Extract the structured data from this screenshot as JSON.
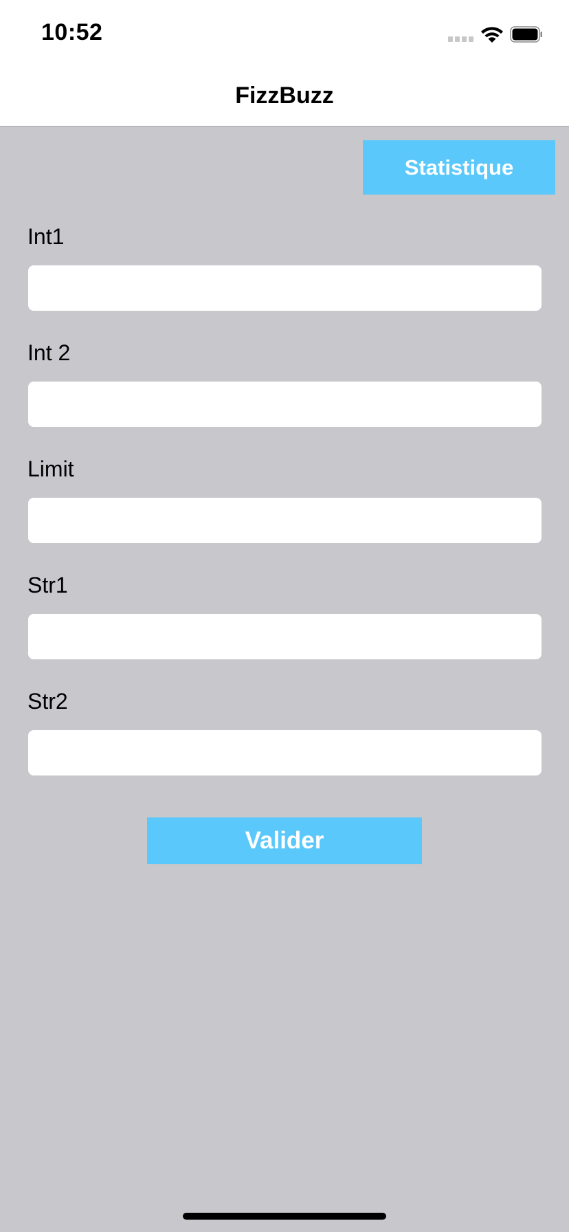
{
  "status_bar": {
    "time": "10:52",
    "signal_icon": "cellular-signal-icon",
    "wifi_icon": "wifi-icon",
    "battery_icon": "battery-icon"
  },
  "nav": {
    "title": "FizzBuzz"
  },
  "toolbar": {
    "stats_label": "Statistique"
  },
  "form": {
    "fields": [
      {
        "label": "Int1",
        "value": "",
        "placeholder": ""
      },
      {
        "label": "Int 2",
        "value": "",
        "placeholder": ""
      },
      {
        "label": "Limit",
        "value": "",
        "placeholder": ""
      },
      {
        "label": "Str1",
        "value": "",
        "placeholder": ""
      },
      {
        "label": "Str2",
        "value": "",
        "placeholder": ""
      }
    ],
    "submit_label": "Valider"
  },
  "colors": {
    "accent": "#5ac8fa",
    "background": "#c7c7cc"
  }
}
